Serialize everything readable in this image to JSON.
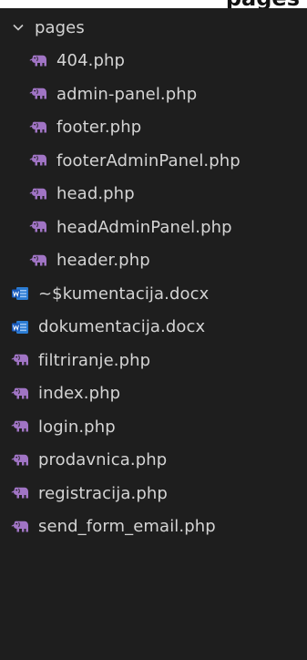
{
  "crop_title": "pages",
  "folder": {
    "name": "pages",
    "expanded": true,
    "chevron_icon": "chevron-down-icon",
    "items": [
      {
        "label": "404.php",
        "icon": "php-elephant-icon"
      },
      {
        "label": "admin-panel.php",
        "icon": "php-elephant-icon"
      },
      {
        "label": "footer.php",
        "icon": "php-elephant-icon"
      },
      {
        "label": "footerAdminPanel.php",
        "icon": "php-elephant-icon"
      },
      {
        "label": "head.php",
        "icon": "php-elephant-icon"
      },
      {
        "label": "headAdminPanel.php",
        "icon": "php-elephant-icon"
      },
      {
        "label": "header.php",
        "icon": "php-elephant-icon"
      }
    ]
  },
  "root_files": [
    {
      "label": "~$kumentacija.docx",
      "icon": "word-doc-icon"
    },
    {
      "label": "dokumentacija.docx",
      "icon": "word-doc-icon"
    },
    {
      "label": "filtriranje.php",
      "icon": "php-elephant-icon"
    },
    {
      "label": "index.php",
      "icon": "php-elephant-icon"
    },
    {
      "label": "login.php",
      "icon": "php-elephant-icon"
    },
    {
      "label": "prodavnica.php",
      "icon": "php-elephant-icon"
    },
    {
      "label": "registracija.php",
      "icon": "php-elephant-icon"
    },
    {
      "label": "send_form_email.php",
      "icon": "php-elephant-icon"
    }
  ],
  "colors": {
    "background": "#1e1e1e",
    "text": "#d4d4d4",
    "php_icon": "#a074c4",
    "docx_icon": "#2b7cd3"
  }
}
